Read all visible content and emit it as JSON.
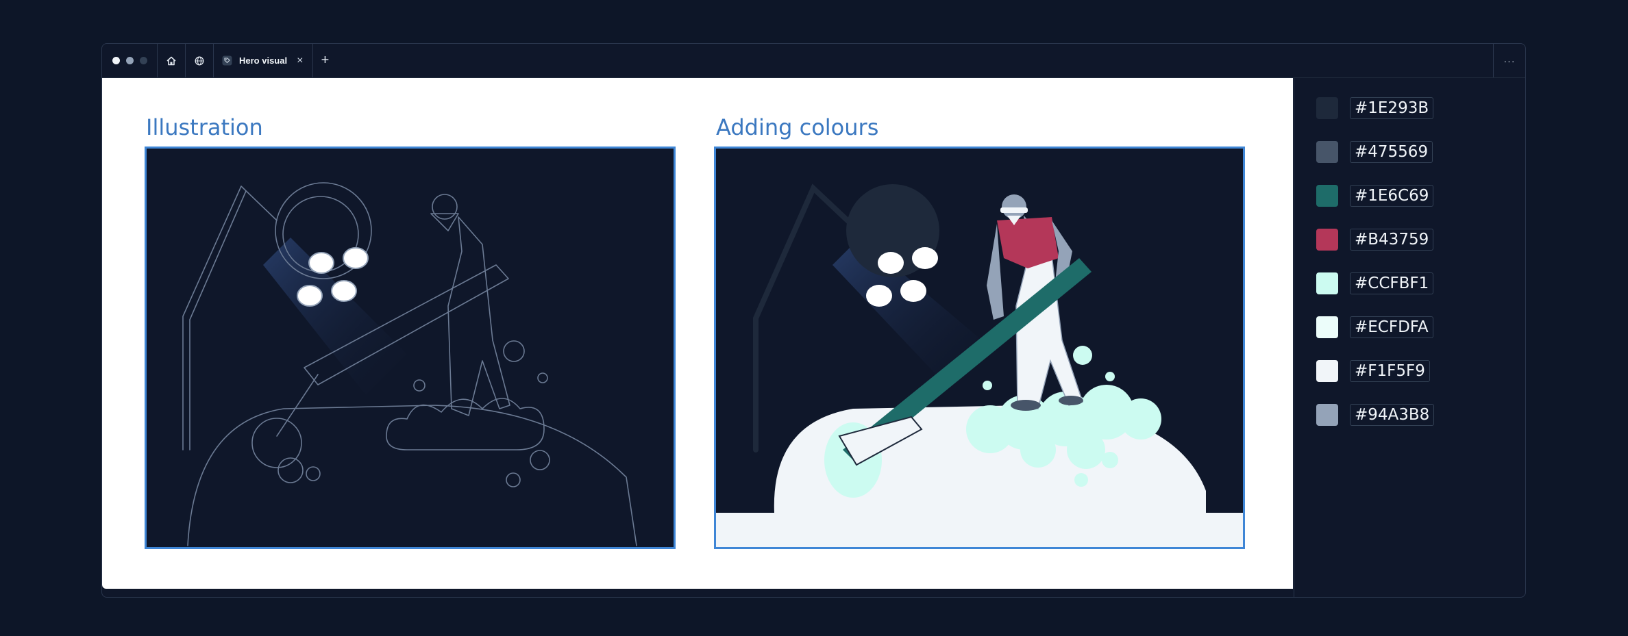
{
  "browser": {
    "tab_title": "Hero visual",
    "tab_close": "×",
    "new_tab": "+",
    "more": "···"
  },
  "panels": [
    {
      "title": "Illustration"
    },
    {
      "title": "Adding colours"
    }
  ],
  "palette": [
    {
      "hex": "#1E293B",
      "color": "#1E293B"
    },
    {
      "hex": "#475569",
      "color": "#475569"
    },
    {
      "hex": "#1E6C69",
      "color": "#1E6C69"
    },
    {
      "hex": "#B43759",
      "color": "#B43759"
    },
    {
      "hex": "#CCFBF1",
      "color": "#CCFBF1"
    },
    {
      "hex": "#ECFDFA",
      "color": "#ECFDFA"
    },
    {
      "hex": "#F1F5F9",
      "color": "#F1F5F9"
    },
    {
      "hex": "#94A3B8",
      "color": "#94A3B8"
    }
  ],
  "icons": {
    "home": "home-icon",
    "globe": "globe-icon",
    "tab": "tag-icon"
  }
}
